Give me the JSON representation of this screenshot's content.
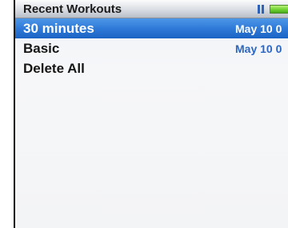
{
  "header": {
    "title": "Recent Workouts"
  },
  "status": {
    "play_state_icon": "pause-icon",
    "battery_icon": "battery-icon",
    "battery_color": "#5cc626"
  },
  "list": {
    "items": [
      {
        "label": "30 minutes",
        "date": "May 10 0",
        "selected": true
      },
      {
        "label": "Basic",
        "date": "May 10 0",
        "selected": false
      },
      {
        "label": "Delete All",
        "date": "",
        "selected": false
      }
    ]
  },
  "colors": {
    "selection": "#2f7ad8",
    "date_text": "#2d66c2"
  }
}
